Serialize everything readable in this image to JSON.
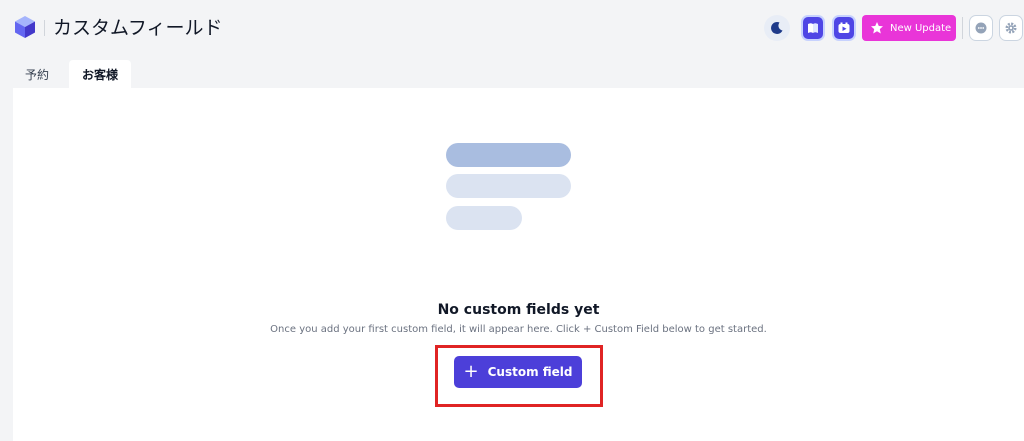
{
  "header": {
    "title": "カスタムフィールド",
    "update_label": "New Update",
    "accent_color": "#4f46e5",
    "update_color": "#e935d8",
    "icons": [
      "logo-icon",
      "moon-icon",
      "book-icon",
      "video-icon",
      "star-icon",
      "chat-icon",
      "gear-icon"
    ]
  },
  "tabs": [
    {
      "label": "予約",
      "active": false
    },
    {
      "label": "お客様",
      "active": true
    }
  ],
  "empty_state": {
    "title": "No custom fields yet",
    "description": "Once you add your first custom field, it will appear here. Click + Custom Field below to get started.",
    "button_label": "Custom field",
    "button_icon": "plus",
    "button_color": "#4c3fd9",
    "highlight_color": "#e02424"
  }
}
